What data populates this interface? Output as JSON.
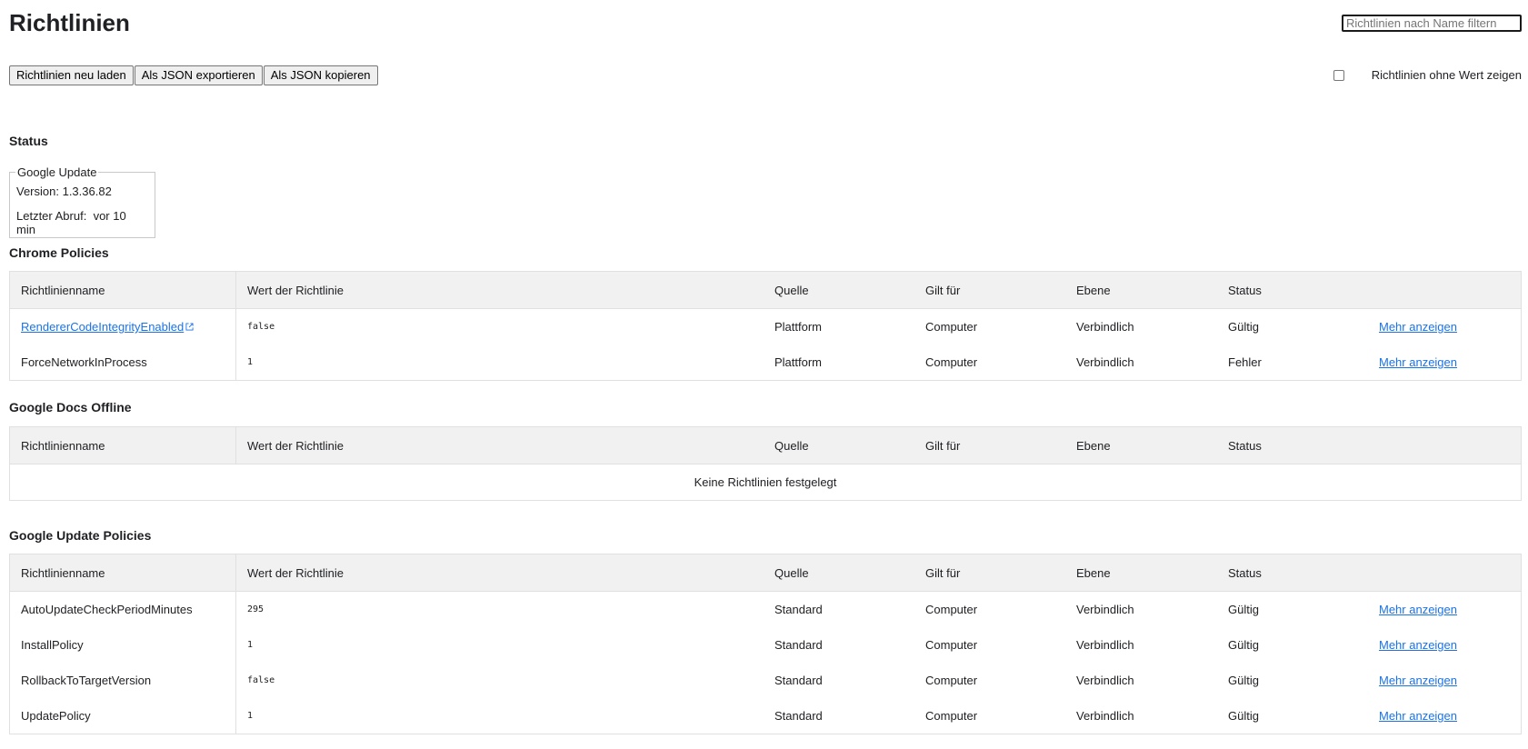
{
  "title": "Richtlinien",
  "filter": {
    "placeholder": "Richtlinien nach Name filtern"
  },
  "toolbar": {
    "reload_label": "Richtlinien neu laden",
    "export_label": "Als JSON exportieren",
    "copy_label": "Als JSON kopieren"
  },
  "show_unset_label": "Richtlinien ohne Wert zeigen",
  "status": {
    "heading": "Status",
    "box_legend": "Google Update",
    "version_label": "Version: 1.3.36.82",
    "last_fetch_label": "Letzter Abruf:",
    "last_fetch_value": "vor 10 min"
  },
  "columns": {
    "name": "Richtlinienname",
    "value": "Wert der Richtlinie",
    "source": "Quelle",
    "scope": "Gilt für",
    "level": "Ebene",
    "status": "Status"
  },
  "more_label": "Mehr anzeigen",
  "chrome": {
    "heading": "Chrome Policies",
    "rows": [
      {
        "name": "RendererCodeIntegrityEnabled",
        "value": "false",
        "source": "Plattform",
        "scope": "Computer",
        "level": "Verbindlich",
        "status": "Gültig"
      },
      {
        "name": "ForceNetworkInProcess",
        "value": "1",
        "source": "Plattform",
        "scope": "Computer",
        "level": "Verbindlich",
        "status": "Fehler"
      }
    ]
  },
  "docs": {
    "heading": "Google Docs Offline",
    "empty_text": "Keine Richtlinien festgelegt"
  },
  "update": {
    "heading": "Google Update Policies",
    "rows": [
      {
        "name": "AutoUpdateCheckPeriodMinutes",
        "value": "295",
        "source": "Standard",
        "scope": "Computer",
        "level": "Verbindlich",
        "status": "Gültig"
      },
      {
        "name": "InstallPolicy",
        "value": "1",
        "source": "Standard",
        "scope": "Computer",
        "level": "Verbindlich",
        "status": "Gültig"
      },
      {
        "name": "RollbackToTargetVersion",
        "value": "false",
        "source": "Standard",
        "scope": "Computer",
        "level": "Verbindlich",
        "status": "Gültig"
      },
      {
        "name": "UpdatePolicy",
        "value": "1",
        "source": "Standard",
        "scope": "Computer",
        "level": "Verbindlich",
        "status": "Gültig"
      }
    ]
  },
  "colors": {
    "link": "#1a73e8",
    "header_bg": "#f1f1f1",
    "border": "#e0e0e0"
  }
}
